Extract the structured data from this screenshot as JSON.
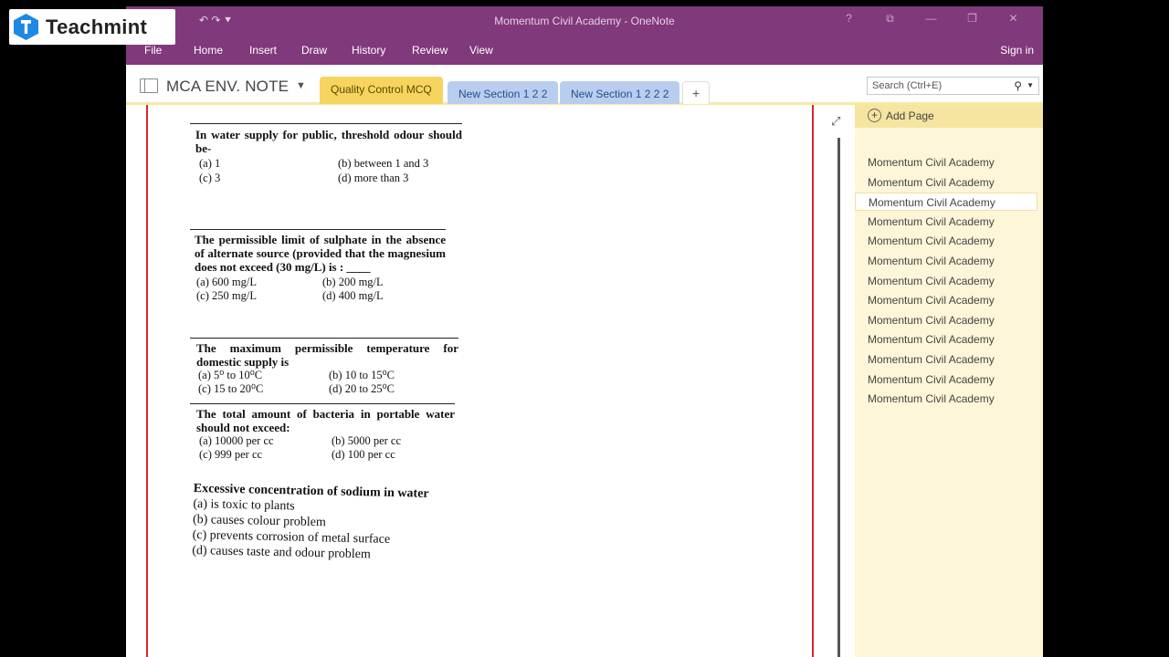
{
  "window": {
    "title": "Momentum Civil Academy - OneNote",
    "controls": [
      "?",
      "⧉",
      "—",
      "❐",
      "✕"
    ]
  },
  "quick_access": {
    "label": "↶  ↷  ⯆"
  },
  "ribbon": {
    "tabs": [
      "File",
      "Home",
      "Insert",
      "Draw",
      "History",
      "Review",
      "View"
    ],
    "sign_in": "Sign in"
  },
  "notebook": {
    "name": "MCA ENV. NOTE",
    "caret": "▼"
  },
  "sections": [
    {
      "label": "Quality Control MCQ",
      "active": true
    },
    {
      "label": "New Section 1 2 2",
      "active": false
    },
    {
      "label": "New Section 1 2 2 2",
      "active": false
    },
    {
      "label": "+",
      "active": false
    }
  ],
  "search": {
    "placeholder": "Search (Ctrl+E)",
    "icon": "search-icon"
  },
  "page_list": {
    "add_page": "Add Page",
    "items": [
      "Momentum Civil Academy",
      "Momentum Civil Academy",
      "Momentum Civil Academy",
      "Momentum Civil Academy",
      "Momentum Civil Academy",
      "Momentum Civil Academy",
      "Momentum Civil Academy",
      "Momentum Civil Academy",
      "Momentum Civil Academy",
      "Momentum Civil Academy",
      "Momentum Civil Academy",
      "Momentum Civil Academy",
      "Momentum Civil Academy"
    ],
    "selected_index": 2
  },
  "questions": [
    {
      "stem": "In water supply for public, threshold odour should be-",
      "options": [
        "(a)  1",
        "(b)  between 1 and 3",
        "(c)  3",
        "(d)  more than 3"
      ]
    },
    {
      "stem": "The permissible limit of sulphate in the absence of alternate source (provided that the magnesium does not exceed (30 mg/L) is : ____",
      "options": [
        "(a)  600 mg/L",
        "(b)  200 mg/L",
        "(c)  250 mg/L",
        "(d)  400 mg/L"
      ]
    },
    {
      "stem": "The maximum permissible temperature for domestic supply is",
      "options": [
        "(a)  5⁰ to 10⁰C",
        "(b)  10 to 15⁰C",
        "(c)  15 to 20⁰C",
        "(d)  20 to 25⁰C"
      ]
    },
    {
      "stem": "The total amount of bacteria in portable water should not exceed:",
      "options": [
        "(a)  10000 per cc",
        "(b)  5000 per cc",
        "(c)  999 per cc",
        "(d)  100 per cc"
      ]
    },
    {
      "stem": "Excessive concentration of sodium in water",
      "options": [
        "(a)  is toxic to plants",
        "(b)  causes colour problem",
        "(c)  prevents corrosion of metal surface",
        "(d)  causes taste and odour problem"
      ]
    }
  ],
  "logo": {
    "text": "Teachmint"
  },
  "colors": {
    "onenote_purple": "#80397b",
    "active_section": "#f6d55e",
    "section_blue": "#b9cdef",
    "page_panel": "#fdf6d8",
    "margin_red": "#d9262d"
  }
}
